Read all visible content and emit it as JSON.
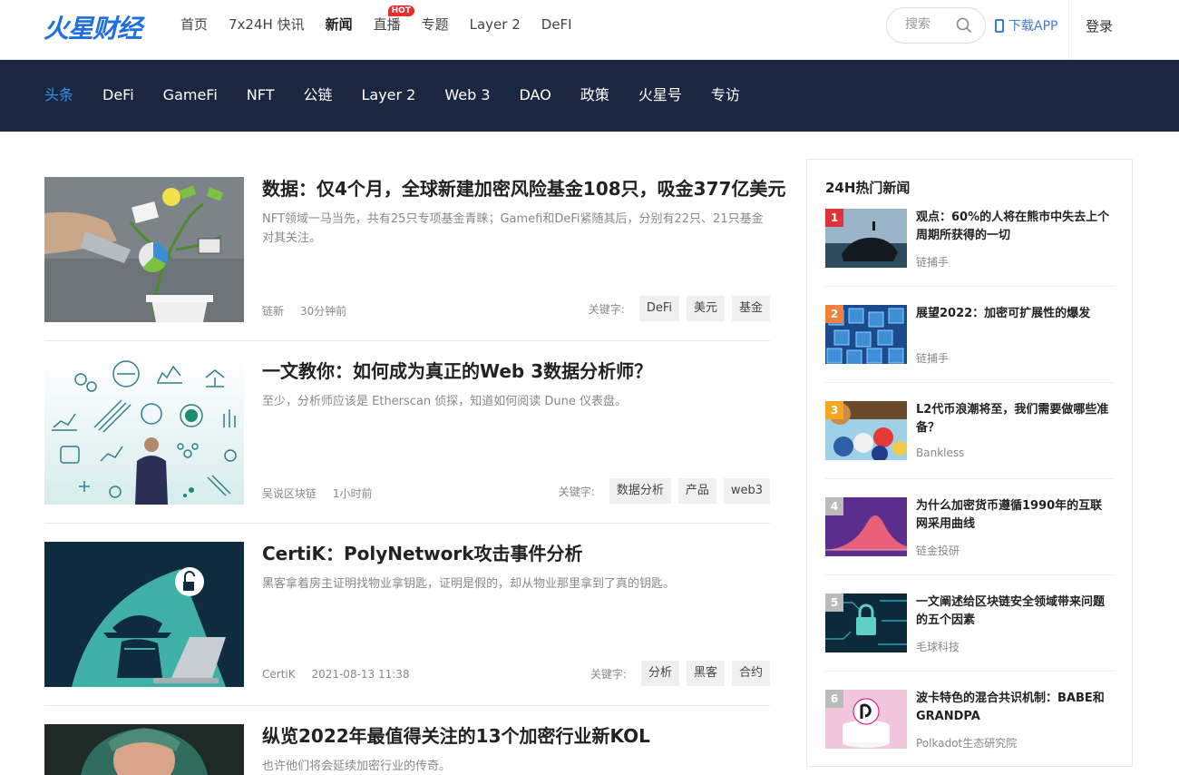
{
  "logo": "火星财经",
  "topnav": [
    {
      "label": "首页",
      "active": false
    },
    {
      "label": "7x24H 快讯",
      "active": false
    },
    {
      "label": "新闻",
      "active": true
    },
    {
      "label": "直播",
      "active": false,
      "badge": "HOT"
    },
    {
      "label": "专题",
      "active": false
    },
    {
      "label": "Layer 2",
      "active": false
    },
    {
      "label": "DeFI",
      "active": false
    }
  ],
  "search": {
    "placeholder": "搜索"
  },
  "download_label": "下载APP",
  "login_label": "登录",
  "subnav": [
    "头条",
    "DeFi",
    "GameFi",
    "NFT",
    "公链",
    "Layer 2",
    "Web 3",
    "DAO",
    "政策",
    "火星号",
    "专访"
  ],
  "keyword_label": "关键字:",
  "articles": [
    {
      "title": "数据：仅4个月，全球新建加密风险基金108只，吸金377亿美元",
      "summary": "NFT领域一马当先，共有25只专项基金青睐；Gamefi和DeFi紧随其后，分别有22只、21只基金对其关注。",
      "author": "链新",
      "time": "30分钟前",
      "tags": [
        "DeFi",
        "美元",
        "基金"
      ]
    },
    {
      "title": "一文教你：如何成为真正的Web 3数据分析师？",
      "summary": "至少，分析师应该是 Etherscan 侦探，知道如何阅读 Dune 仪表盘。",
      "author": "吴说区块链",
      "time": "1小时前",
      "tags": [
        "数据分析",
        "产品",
        "web3"
      ]
    },
    {
      "title": "CertiK：PolyNetwork攻击事件分析",
      "summary": "黑客拿着房主证明找物业拿钥匙，证明是假的，却从物业那里拿到了真的钥匙。",
      "author": "CertiK",
      "time": "2021-08-13 11:38",
      "tags": [
        "分析",
        "黑客",
        "合约"
      ]
    },
    {
      "title": "纵览2022年最值得关注的13个加密行业新KOL",
      "summary": "也许他们将会延续加密行业的传奇。",
      "author": "",
      "time": "",
      "tags": []
    }
  ],
  "hot": {
    "title": "24H热门新闻",
    "rank_colors": [
      "#e0323a",
      "#f0803c",
      "#f5a623",
      "#bbbbbb",
      "#bbbbbb",
      "#bbbbbb"
    ],
    "items": [
      {
        "rank": "1",
        "title": "观点：60%的人将在熊市中失去上个周期所获得的一切",
        "source": "链捕手"
      },
      {
        "rank": "2",
        "title": "展望2022：加密可扩展性的爆发",
        "source": "链捕手"
      },
      {
        "rank": "3",
        "title": "L2代币浪潮将至，我们需要做哪些准备？",
        "source": "Bankless"
      },
      {
        "rank": "4",
        "title": "为什么加密货币遵循1990年的互联网采用曲线",
        "source": "链金投研"
      },
      {
        "rank": "5",
        "title": "一文阐述给区块链安全领域带来问题的五个因素",
        "source": "毛球科技"
      },
      {
        "rank": "6",
        "title": "波卡特色的混合共识机制：BABE和GRANDPA",
        "source": "Polkadot生态研究院"
      }
    ]
  }
}
